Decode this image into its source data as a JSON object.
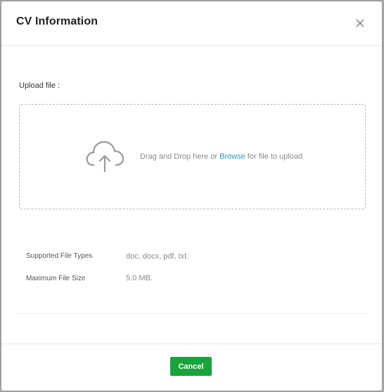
{
  "modal": {
    "title": "CV Information",
    "close_icon": "close-icon"
  },
  "upload": {
    "label": "Upload file :",
    "drop_text_before": "Drag and Drop here or",
    "browse_label": "Browse",
    "drop_text_after": "for file to upload",
    "icon": "cloud-upload-icon"
  },
  "file_info": {
    "supported_types_label": "Supported File Types",
    "supported_types_value": "doc, docx, pdf, txt.",
    "max_size_label": "Maximum File Size",
    "max_size_value": "5.0 MB."
  },
  "footer": {
    "cancel_label": "Cancel"
  },
  "colors": {
    "accent_green": "#1aa33a",
    "link_blue": "#2b95c9"
  }
}
